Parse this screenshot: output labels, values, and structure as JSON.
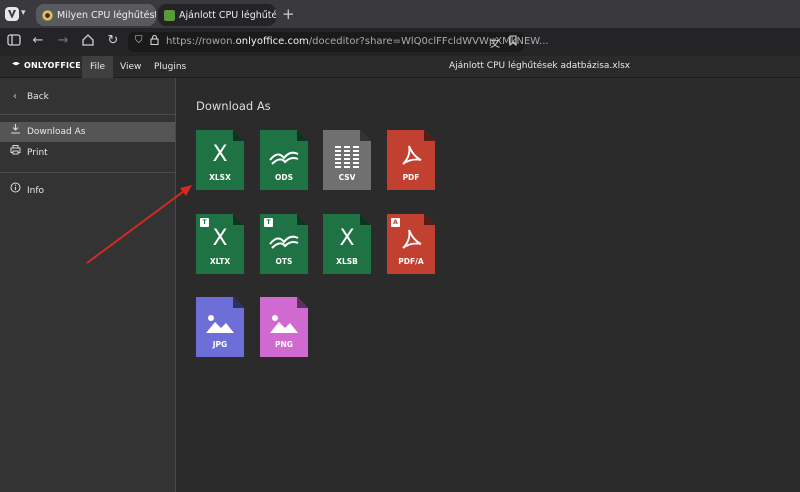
{
  "browser": {
    "tabs": [
      {
        "label": "Milyen CPU léghűtést ve...",
        "active": false
      },
      {
        "label": "Ajánlott CPU léghűtések a",
        "active": true
      }
    ],
    "new_tab_icon": "plus-icon",
    "url_prefix": "https://rowon.",
    "url_domain": "onlyoffice.com",
    "url_rest": "/doceditor?share=WlQ0clFFcldWVWpXMkNEW..."
  },
  "app": {
    "logo": "ONLYOFFICE",
    "menu": [
      "File",
      "View",
      "Plugins"
    ],
    "active_menu": "File",
    "document_title": "Ajánlott CPU léghűtések adatbázisa.xlsx"
  },
  "sidebar": {
    "back": "Back",
    "items": [
      {
        "label": "Download As",
        "icon": "download-icon",
        "active": true
      },
      {
        "label": "Print",
        "icon": "printer-icon",
        "active": false
      },
      {
        "label": "Info",
        "icon": "info-icon",
        "active": false
      }
    ]
  },
  "main": {
    "heading": "Download As",
    "formats": [
      {
        "label": "XLSX",
        "glyph": "X",
        "kind": "green",
        "badge": ""
      },
      {
        "label": "ODS",
        "glyph": "ods",
        "kind": "green",
        "badge": ""
      },
      {
        "label": "CSV",
        "glyph": "csv",
        "kind": "gray",
        "badge": ""
      },
      {
        "label": "PDF",
        "glyph": "pdf",
        "kind": "red",
        "badge": ""
      },
      {
        "label": "XLTX",
        "glyph": "X",
        "kind": "green",
        "badge": "T"
      },
      {
        "label": "OTS",
        "glyph": "ods",
        "kind": "green",
        "badge": "T"
      },
      {
        "label": "XLSB",
        "glyph": "X",
        "kind": "green",
        "badge": ""
      },
      {
        "label": "PDF/A",
        "glyph": "pdf",
        "kind": "red",
        "badge": "A"
      },
      {
        "label": "JPG",
        "glyph": "img",
        "kind": "purple",
        "badge": ""
      },
      {
        "label": "PNG",
        "glyph": "img",
        "kind": "pink",
        "badge": ""
      }
    ]
  },
  "colors": {
    "accent_arrow": "#d42a20",
    "xlsx_green": "#1f7244",
    "pdf_red": "#c24030",
    "csv_gray": "#707070",
    "jpg_purple": "#6e6ed8",
    "png_pink": "#d16ad0"
  }
}
